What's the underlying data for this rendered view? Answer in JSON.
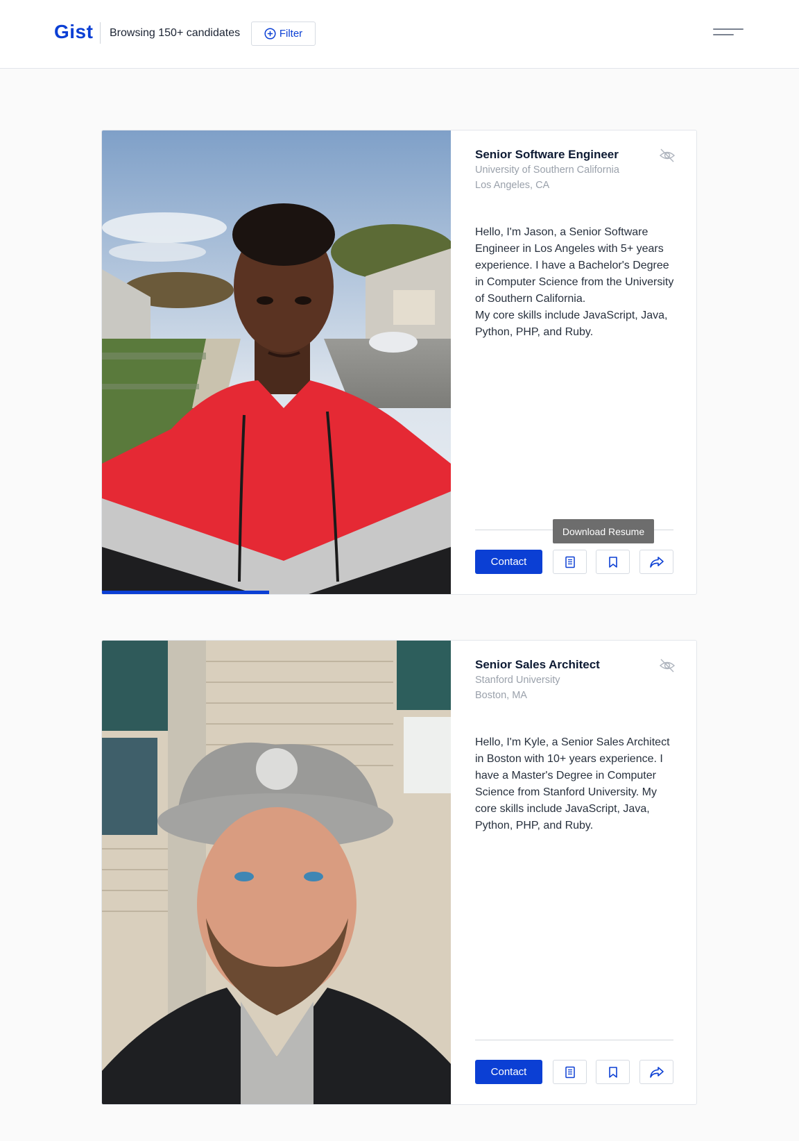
{
  "header": {
    "logo": "Gist",
    "browsing_text": "Browsing 150+ candidates",
    "filter_label": "Filter",
    "brand_color": "#0b3fd4"
  },
  "candidates": [
    {
      "title": "Senior Software Engineer",
      "school": "University of Southern California",
      "location": "Los Angeles, CA",
      "bio": "Hello, I'm Jason, a Senior Software Engineer in Los Angeles with 5+ years experience. I have a Bachelor's Degree in Computer Science from the University of Southern California.\nMy core skills include JavaScript, Java, Python, PHP, and Ruby.",
      "contact_label": "Contact",
      "tooltip": "Download Resume",
      "progress_fraction": 0.48
    },
    {
      "title": "Senior Sales Architect",
      "school": "Stanford University",
      "location": "Boston, MA",
      "bio": "Hello, I'm Kyle, a Senior Sales Architect in Boston with 10+ years experience. I have a Master's Degree in Computer Science from Stanford University. My core skills include JavaScript, Java, Python, PHP, and Ruby.",
      "contact_label": "Contact"
    }
  ],
  "icons": {
    "filter": "plus-circle-icon",
    "menu": "hamburger-menu-icon",
    "hide": "eye-off-icon",
    "resume": "document-icon",
    "bookmark": "bookmark-icon",
    "share": "share-arrow-icon"
  }
}
